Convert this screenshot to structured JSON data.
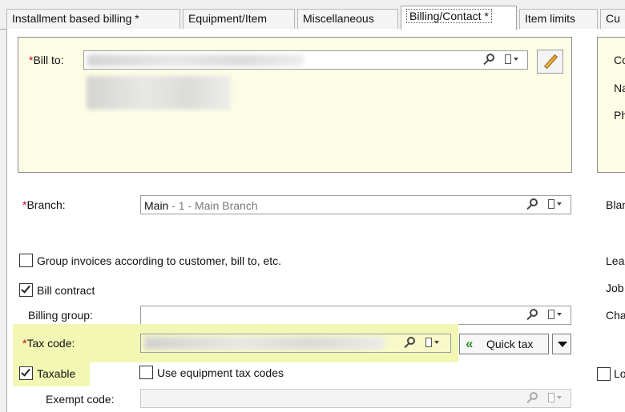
{
  "tabs": [
    {
      "label": "Installment based billing *"
    },
    {
      "label": "Equipment/Item"
    },
    {
      "label": "Miscellaneous"
    },
    {
      "label": "Billing/Contact *"
    },
    {
      "label": "Item limits"
    },
    {
      "label": "Cu"
    }
  ],
  "active_tab": "Billing/Contact *",
  "bill_to": {
    "required": "*",
    "label": "Bill to:",
    "value": ""
  },
  "right_panel": {
    "labels": [
      "Co",
      "Na",
      "Ph"
    ]
  },
  "branch": {
    "required": "*",
    "label": "Branch:",
    "value_main": "Main",
    "value_suffix": " - 1 - Main Branch"
  },
  "right_labels": {
    "blanket": "Blan",
    "lease": "Lea",
    "job": "Job",
    "charge": "Cha",
    "lo": "Lo"
  },
  "group_invoices": {
    "label": "Group invoices according to customer, bill to, etc.",
    "checked": false
  },
  "bill_contract": {
    "label": "Bill contract",
    "checked": true
  },
  "billing_group": {
    "label": "Billing group:",
    "value": ""
  },
  "tax_code": {
    "required": "*",
    "label": "Tax code:",
    "value": ""
  },
  "quick_tax": {
    "label": "Quick tax",
    "icon": "double-chevron-left-icon"
  },
  "taxable": {
    "label": "Taxable",
    "checked": true
  },
  "use_equipment_tax": {
    "label": "Use equipment tax codes",
    "checked": false
  },
  "exempt_code": {
    "label": "Exempt code:",
    "value": ""
  },
  "colors": {
    "panel_bg": "#fdfde6",
    "highlight": "#f2f7b4",
    "required": "#d0021b",
    "quick_tax_icon": "#2e8b2e"
  }
}
